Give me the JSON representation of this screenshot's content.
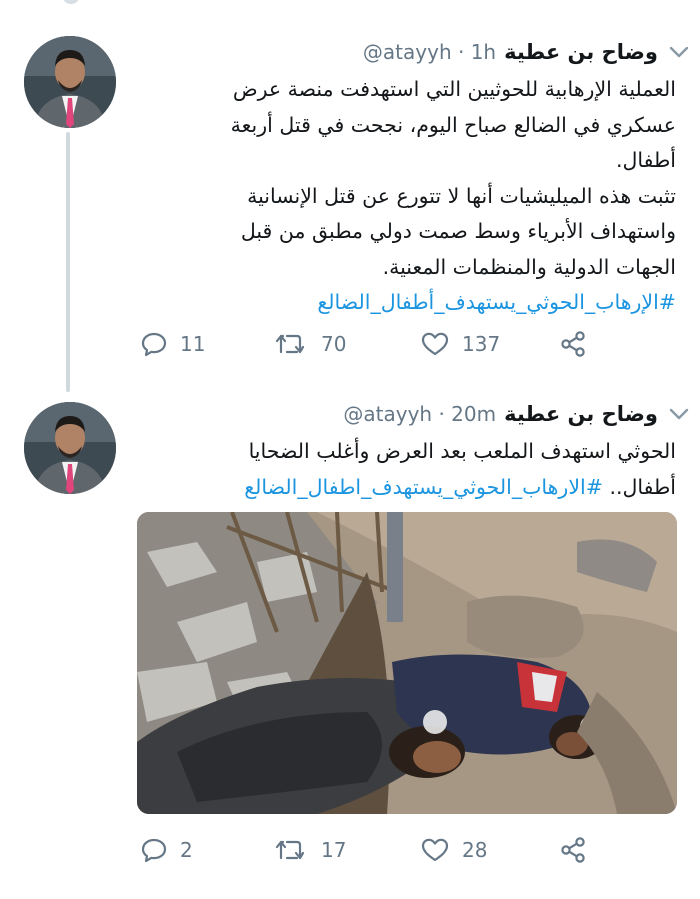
{
  "tweets": [
    {
      "author_name": "وضاح بن عطية",
      "handle": "@atayyh",
      "time": "· 1h",
      "lines": [
        "العملية الإرهابية للحوثيين التي استهدفت منصة عرض",
        "عسكري في الضالع صباح اليوم، نجحت في قتل أربعة",
        "أطفال.",
        "تثبت هذه الميليشيات أنها لا تتورع عن قتل الإنسانية",
        "واستهداف الأبرياء وسط صمت دولي مطبق من قبل",
        "الجهات الدولية والمنظمات المعنية."
      ],
      "hashtag": "#الإرهاب_الحوثي_يستهدف_أطفال_الضالع",
      "replies": "11",
      "retweets": "70",
      "likes": "137"
    },
    {
      "author_name": "وضاح بن عطية",
      "handle": "@atayyh",
      "time": "· 20m",
      "line1": "الحوثي استهدف الملعب بعد العرض وأغلب الضحايا",
      "line2_text": "أطفال..",
      "hashtag": "#الارهاب_الحوثي_يستهدف_اطفال_الضالع",
      "replies": "2",
      "retweets": "17",
      "likes": "28"
    }
  ],
  "colors": {
    "link": "#1b95e0",
    "muted": "#657786",
    "text": "#14171a"
  },
  "icons": [
    "reply-icon",
    "retweet-icon",
    "like-icon",
    "share-icon",
    "chevron-down-icon"
  ]
}
